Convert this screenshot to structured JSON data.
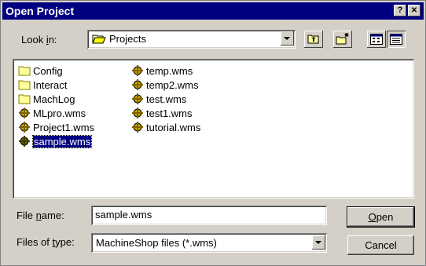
{
  "window": {
    "title": "Open Project",
    "help_glyph": "?",
    "close_glyph": "✕"
  },
  "lookin": {
    "label_pre": "Look ",
    "label_u": "i",
    "label_post": "n:",
    "value": "Projects",
    "icon": "folder-open-icon"
  },
  "toolbar": {
    "icons": [
      "up-one-level-icon",
      "new-folder-icon",
      "list-view-icon",
      "details-view-icon"
    ]
  },
  "files": [
    {
      "name": "Config",
      "icon": "folder-icon",
      "selected": false
    },
    {
      "name": "Interact",
      "icon": "folder-icon",
      "selected": false
    },
    {
      "name": "MachLog",
      "icon": "folder-icon",
      "selected": false
    },
    {
      "name": "MLpro.wms",
      "icon": "project-file-icon",
      "selected": false
    },
    {
      "name": "Project1.wms",
      "icon": "project-file-icon",
      "selected": false
    },
    {
      "name": "sample.wms",
      "icon": "project-file-icon",
      "selected": true
    },
    {
      "name": "temp.wms",
      "icon": "project-file-icon",
      "selected": false
    },
    {
      "name": "temp2.wms",
      "icon": "project-file-icon",
      "selected": false
    },
    {
      "name": "test.wms",
      "icon": "project-file-icon",
      "selected": false
    },
    {
      "name": "test1.wms",
      "icon": "project-file-icon",
      "selected": false
    },
    {
      "name": "tutorial.wms",
      "icon": "project-file-icon",
      "selected": false
    }
  ],
  "filename": {
    "label_pre": "File ",
    "label_u": "n",
    "label_post": "ame:",
    "value": "sample.wms"
  },
  "filetype": {
    "label_pre": "Files of ",
    "label_u": "t",
    "label_post": "ype:",
    "value": "MachineShop files (*.wms)"
  },
  "buttons": {
    "open_u": "O",
    "open_rest": "pen",
    "cancel": "Cancel"
  }
}
